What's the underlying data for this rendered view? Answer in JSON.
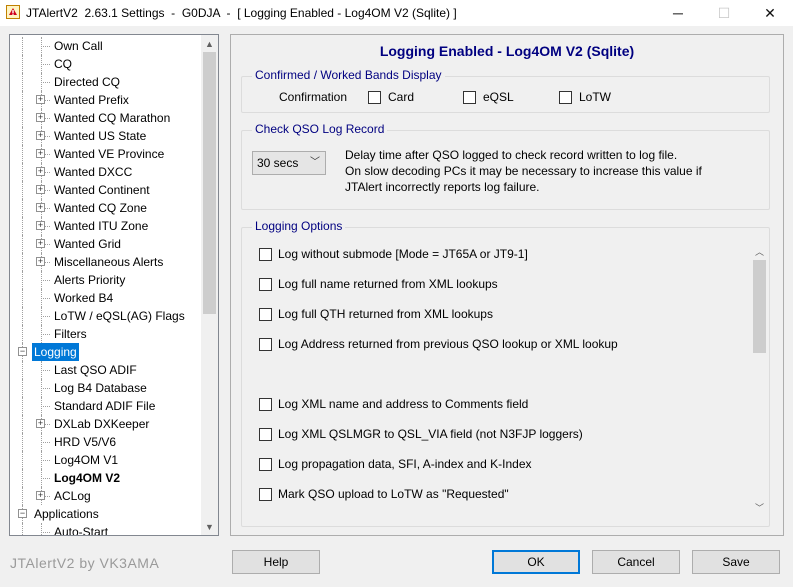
{
  "window": {
    "title": "JTAlertV2  2.63.1 Settings  -  G0DJA  -  [ Logging Enabled - Log4OM V2 (Sqlite) ]",
    "controls": {
      "minimize": "─",
      "maximize": "☐",
      "close": "✕"
    }
  },
  "tree": {
    "items": [
      {
        "label": "Own Call",
        "level": 2,
        "expandable": false
      },
      {
        "label": "CQ",
        "level": 2,
        "expandable": false
      },
      {
        "label": "Directed CQ",
        "level": 2,
        "expandable": false
      },
      {
        "label": "Wanted Prefix",
        "level": 2,
        "expandable": true
      },
      {
        "label": "Wanted CQ Marathon",
        "level": 2,
        "expandable": true
      },
      {
        "label": "Wanted US State",
        "level": 2,
        "expandable": true
      },
      {
        "label": "Wanted VE Province",
        "level": 2,
        "expandable": true
      },
      {
        "label": "Wanted DXCC",
        "level": 2,
        "expandable": true
      },
      {
        "label": "Wanted Continent",
        "level": 2,
        "expandable": true
      },
      {
        "label": "Wanted CQ Zone",
        "level": 2,
        "expandable": true
      },
      {
        "label": "Wanted ITU Zone",
        "level": 2,
        "expandable": true
      },
      {
        "label": "Wanted Grid",
        "level": 2,
        "expandable": true
      },
      {
        "label": "Miscellaneous Alerts",
        "level": 2,
        "expandable": true
      },
      {
        "label": "Alerts Priority",
        "level": 2,
        "expandable": false
      },
      {
        "label": "Worked B4",
        "level": 2,
        "expandable": false
      },
      {
        "label": "LoTW / eQSL(AG) Flags",
        "level": 2,
        "expandable": false
      },
      {
        "label": "Filters",
        "level": 2,
        "expandable": false
      },
      {
        "label": "Logging",
        "level": 1,
        "expandable": true,
        "expanded": true,
        "selected": true
      },
      {
        "label": "Last QSO ADIF",
        "level": 2,
        "expandable": false
      },
      {
        "label": "Log B4 Database",
        "level": 2,
        "expandable": false
      },
      {
        "label": "Standard ADIF File",
        "level": 2,
        "expandable": false
      },
      {
        "label": "DXLab DXKeeper",
        "level": 2,
        "expandable": true
      },
      {
        "label": "HRD V5/V6",
        "level": 2,
        "expandable": false
      },
      {
        "label": "Log4OM V1",
        "level": 2,
        "expandable": false
      },
      {
        "label": "Log4OM V2",
        "level": 2,
        "expandable": false,
        "bold": true
      },
      {
        "label": "ACLog",
        "level": 2,
        "expandable": true
      },
      {
        "label": "Applications",
        "level": 1,
        "expandable": true,
        "expanded": true
      },
      {
        "label": "Auto-Start",
        "level": 2,
        "expandable": false
      }
    ]
  },
  "main": {
    "title": "Logging Enabled - Log4OM V2 (Sqlite)",
    "bands_group": {
      "legend": "Confirmed / Worked Bands Display",
      "label": "Confirmation",
      "options": [
        {
          "label": "Card",
          "checked": false
        },
        {
          "label": "eQSL",
          "checked": false
        },
        {
          "label": "LoTW",
          "checked": false
        }
      ]
    },
    "check_group": {
      "legend": "Check QSO Log Record",
      "select_value": "30 secs",
      "description": [
        "Delay time after QSO logged to check record written to log file.",
        "On slow decoding PCs it may be necessary to increase this value if",
        "JTAlert incorrectly reports log failure."
      ]
    },
    "logging_group": {
      "legend": "Logging Options",
      "options": [
        {
          "label": "Log without submode [Mode = JT65A or JT9-1]",
          "checked": false
        },
        {
          "label": "Log full name returned from XML lookups",
          "checked": false
        },
        {
          "label": "Log full QTH returned from XML lookups",
          "checked": false
        },
        {
          "label": "Log Address returned from previous QSO lookup or XML lookup",
          "checked": false
        },
        {
          "label": "Log XML name and address to Comments field",
          "checked": false
        },
        {
          "label": "Log XML QSLMGR to QSL_VIA field (not N3FJP loggers)",
          "checked": false
        },
        {
          "label": "Log propagation data, SFI, A-index and K-Index",
          "checked": false
        },
        {
          "label": "Mark QSO upload to LoTW as \"Requested\"",
          "checked": false
        }
      ]
    }
  },
  "footer": {
    "brand": "JTAlertV2 by VK3AMA",
    "help": "Help",
    "ok": "OK",
    "cancel": "Cancel",
    "save": "Save"
  }
}
